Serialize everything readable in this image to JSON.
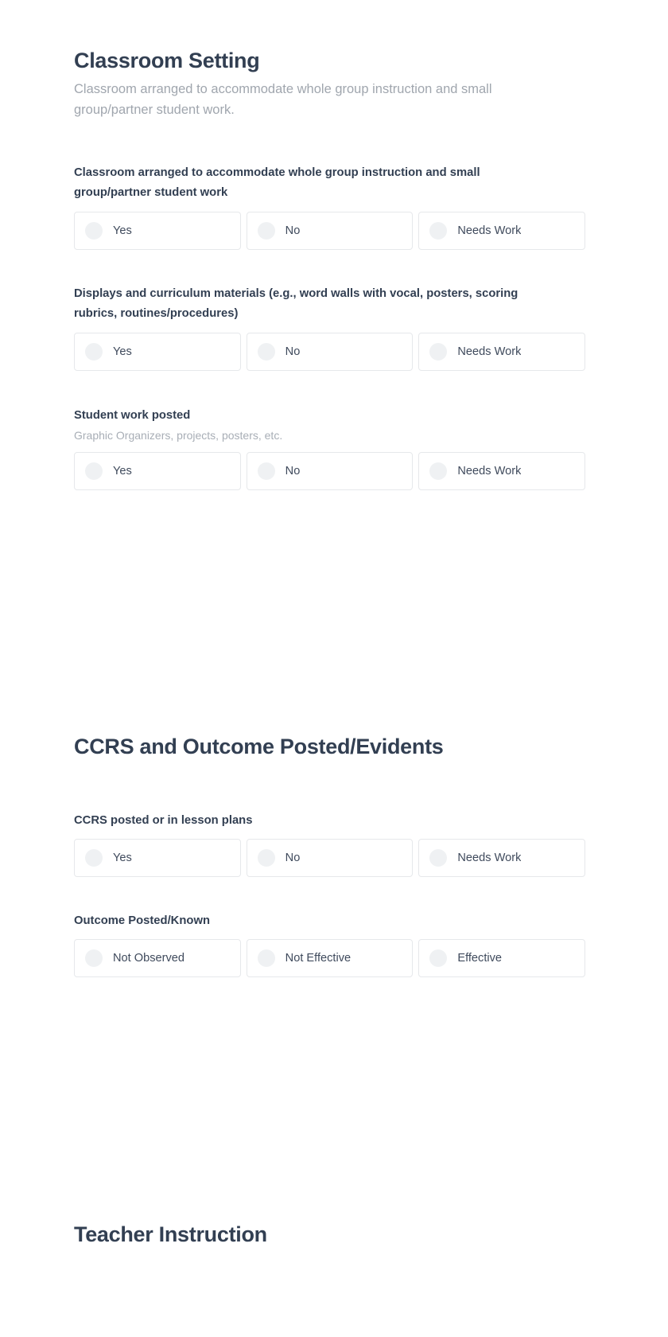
{
  "theme": {
    "page_background": "#ffffff",
    "heading_color": "#323f52",
    "muted_text_color": "#a0a6ae",
    "card_border_color": "#e6e8eb",
    "radio_fill_color": "#eff1f3",
    "option_label_color": "#3f4a5c"
  },
  "sections": [
    {
      "id": "classroom-setting",
      "title": "Classroom Setting",
      "description": "Classroom arranged to accommodate whole group instruction and small group/partner student work.",
      "questions": [
        {
          "id": "classroom-arranged",
          "label": "Classroom arranged to accommodate whole group instruction and small group/partner student work",
          "help": "",
          "options": [
            {
              "label": "Yes",
              "selected": false
            },
            {
              "label": "No",
              "selected": false
            },
            {
              "label": "Needs Work",
              "selected": false
            }
          ]
        },
        {
          "id": "displays-and-curriculum-materials",
          "label": "Displays and curriculum materials (e.g., word walls with vocal, posters, scoring rubrics, routines/procedures)",
          "help": "",
          "options": [
            {
              "label": "Yes",
              "selected": false
            },
            {
              "label": "No",
              "selected": false
            },
            {
              "label": "Needs Work",
              "selected": false
            }
          ]
        },
        {
          "id": "student-work-posted",
          "label": "Student work posted",
          "help": "Graphic Organizers, projects, posters, etc.",
          "options": [
            {
              "label": "Yes",
              "selected": false
            },
            {
              "label": "No",
              "selected": false
            },
            {
              "label": "Needs Work",
              "selected": false
            }
          ]
        }
      ]
    },
    {
      "id": "ccrs-and-outcome",
      "title": "CCRS and Outcome Posted/Evidents",
      "description": "",
      "questions": [
        {
          "id": "ccrs-posted",
          "label": "CCRS posted or in lesson plans",
          "help": "",
          "options": [
            {
              "label": "Yes",
              "selected": false
            },
            {
              "label": "No",
              "selected": false
            },
            {
              "label": "Needs Work",
              "selected": false
            }
          ]
        },
        {
          "id": "outcome-posted-known",
          "label": "Outcome Posted/Known",
          "help": "",
          "options": [
            {
              "label": "Not Observed",
              "selected": false
            },
            {
              "label": "Not Effective",
              "selected": false
            },
            {
              "label": "Effective",
              "selected": false
            }
          ]
        }
      ]
    },
    {
      "id": "teacher-instruction",
      "title": "Teacher Instruction",
      "description": "",
      "questions": []
    }
  ]
}
